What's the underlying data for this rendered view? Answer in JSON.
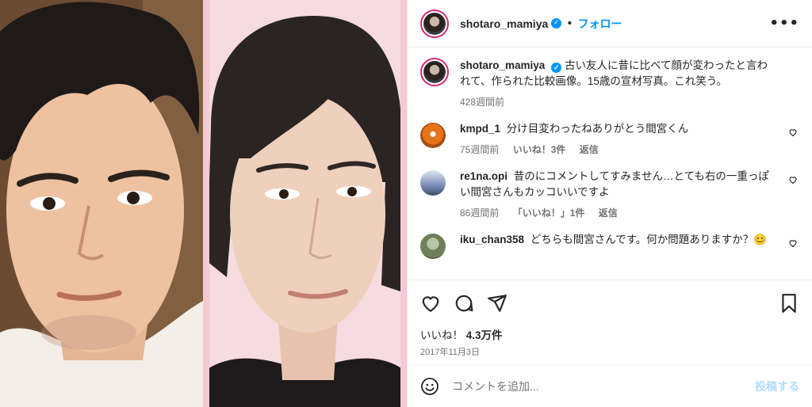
{
  "post": {
    "username": "shotaro_mamiya",
    "verified_icon": "verified-badge-icon",
    "separator": "•",
    "follow_label": "フォロー",
    "more_icon": "more-options-icon",
    "more_label": "•••"
  },
  "caption": {
    "username": "shotaro_mamiya",
    "text": "古い友人に昔に比べて顔が変わったと言われて、作られた比較画像。15歳の宣材写真。これ笑う。",
    "time": "428週間前"
  },
  "comments": [
    {
      "username": "kmpd_1",
      "text": "分け目変わったねありがとう間宮くん",
      "time": "75週間前",
      "likes": "いいね！3件",
      "reply": "返信",
      "avatar_color": "#e8731d"
    },
    {
      "username": "re1na.opi",
      "text": "昔のにコメントしてすみません…とても右の一重っぽい間宮さんもカッコいいですよ",
      "time": "86週間前",
      "likes": "「いいね！」1件",
      "reply": "返信",
      "avatar_color": "#7a8fb8"
    },
    {
      "username": "iku_chan358",
      "text": "どちらも間宮さんです。何か問題ありますか？😊",
      "time": "",
      "likes": "",
      "reply": "",
      "avatar_color": "#6f7f5a"
    }
  ],
  "actions": {
    "like_icon": "heart-icon",
    "comment_icon": "comment-icon",
    "share_icon": "share-icon",
    "save_icon": "bookmark-icon"
  },
  "likes_label": "いいね！",
  "likes_count": "4.3万件",
  "date": "2017年11月3日",
  "composer": {
    "placeholder": "コメントを追加...",
    "post_label": "投稿する",
    "emoji_icon": "emoji-icon"
  },
  "colors": {
    "accent": "#0095f6",
    "text": "#262626",
    "muted": "#737373",
    "divider": "#efefef"
  }
}
